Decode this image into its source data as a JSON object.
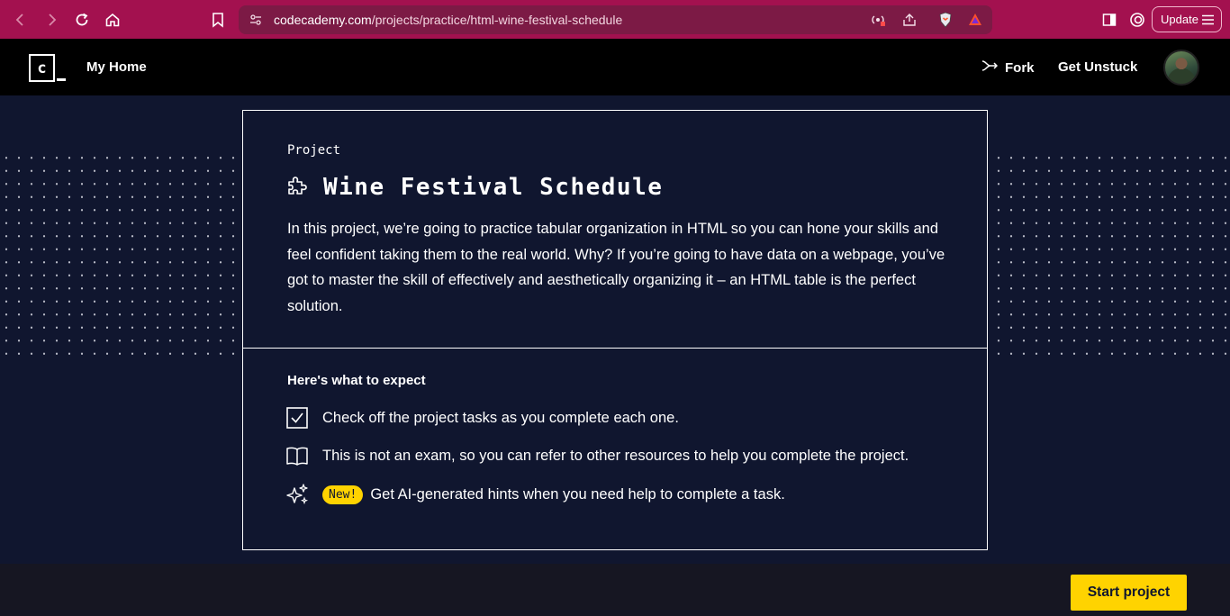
{
  "browser": {
    "url_host": "codecademy.com",
    "url_path": "/projects/practice/html-wine-festival-schedule",
    "update_label": "Update"
  },
  "header": {
    "logo_letter": "c",
    "my_home": "My Home",
    "fork": "Fork",
    "get_unstuck": "Get Unstuck"
  },
  "card": {
    "project_label": "Project",
    "title": "Wine Festival Schedule",
    "description": "In this project, we’re going to practice tabular organization in HTML so you can hone your skills and feel confident taking them to the real world. Why? If you’re going to have data on a webpage, you’ve got to master the skill of effectively and aesthetically organizing it – an HTML table is the perfect solution.",
    "expect_heading": "Here's what to expect",
    "expectations": [
      {
        "icon": "checkbox-icon",
        "text": "Check off the project tasks as you complete each one."
      },
      {
        "icon": "book-icon",
        "text": "This is not an exam, so you can refer to other resources to help you complete the project."
      },
      {
        "icon": "sparkle-icon",
        "badge": "New!",
        "text": "Get AI-generated hints when you need help to complete a task."
      }
    ]
  },
  "footer": {
    "start_label": "Start project"
  },
  "colors": {
    "browser_bar": "#a3114f",
    "page_bg": "#10162f",
    "accent_yellow": "#ffd300"
  }
}
